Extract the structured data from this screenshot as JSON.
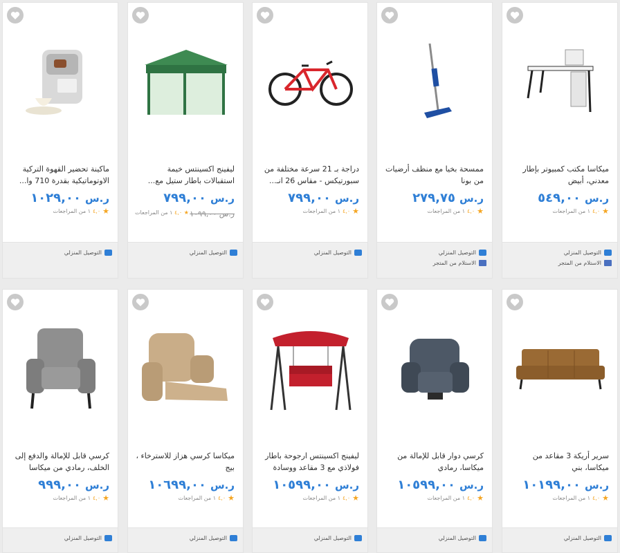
{
  "rating_suffix": "١ من المراجعات",
  "rating_score": "٤,٠",
  "currency": "ر.س",
  "home_delivery": "التوصيل المنزلي",
  "store_pickup": "الاستلام من المتجر",
  "products": [
    {
      "name": "ماكينة تحضير القهوة التركية الاوتوماتيكية بقدرة 710 وا...",
      "price": "١٠٢٩,٠٠"
    },
    {
      "name": "ليفينج اكسينتس خيمة استقبالات باطار ستيل مع...",
      "price": "٧٩٩,٠٠",
      "old_price": "١٠٩٩,٠٠",
      "rating_score": "٤,٠",
      "rating_suffix": "١ من المراجعات"
    },
    {
      "name": "دراجة بـ 21 سرعة مختلفة من سبورتيكس - مقاس 26 انـ...",
      "price": "٧٩٩,٠٠"
    },
    {
      "name": "ممسحة بخيا مع منظف أرضيات من بونا",
      "price": "٢٧٩,٧٥",
      "store_pickup": true
    },
    {
      "name": "ميكاسا مكتب كمبيوتر بإطار معدني، أبيض",
      "price": "٥٤٩,٠٠",
      "store_pickup": true
    },
    {
      "name": "كرسي قابل للإمالة والدفع إلى الخلف، رمادي من ميكاسا",
      "price": "٩٩٩,٠٠"
    },
    {
      "name": "ميكاسا كرسي هزاز للاسترخاء ، بيج",
      "price": "١٠٦٩٩,٠٠"
    },
    {
      "name": "ليفينج اكسينتس ارجوحة باطار فولاذي مع 3 مقاعد ووسادة",
      "price": "١٠٥٩٩,٠٠"
    },
    {
      "name": "كرسي دوار قابل للإمالة من ميكاسا، رمادي",
      "price": "١٠٥٩٩,٠٠"
    },
    {
      "name": "سرير أريكة 3 مقاعد من ميكاسا، بني",
      "price": "١٠١٩٩,٠٠"
    }
  ]
}
